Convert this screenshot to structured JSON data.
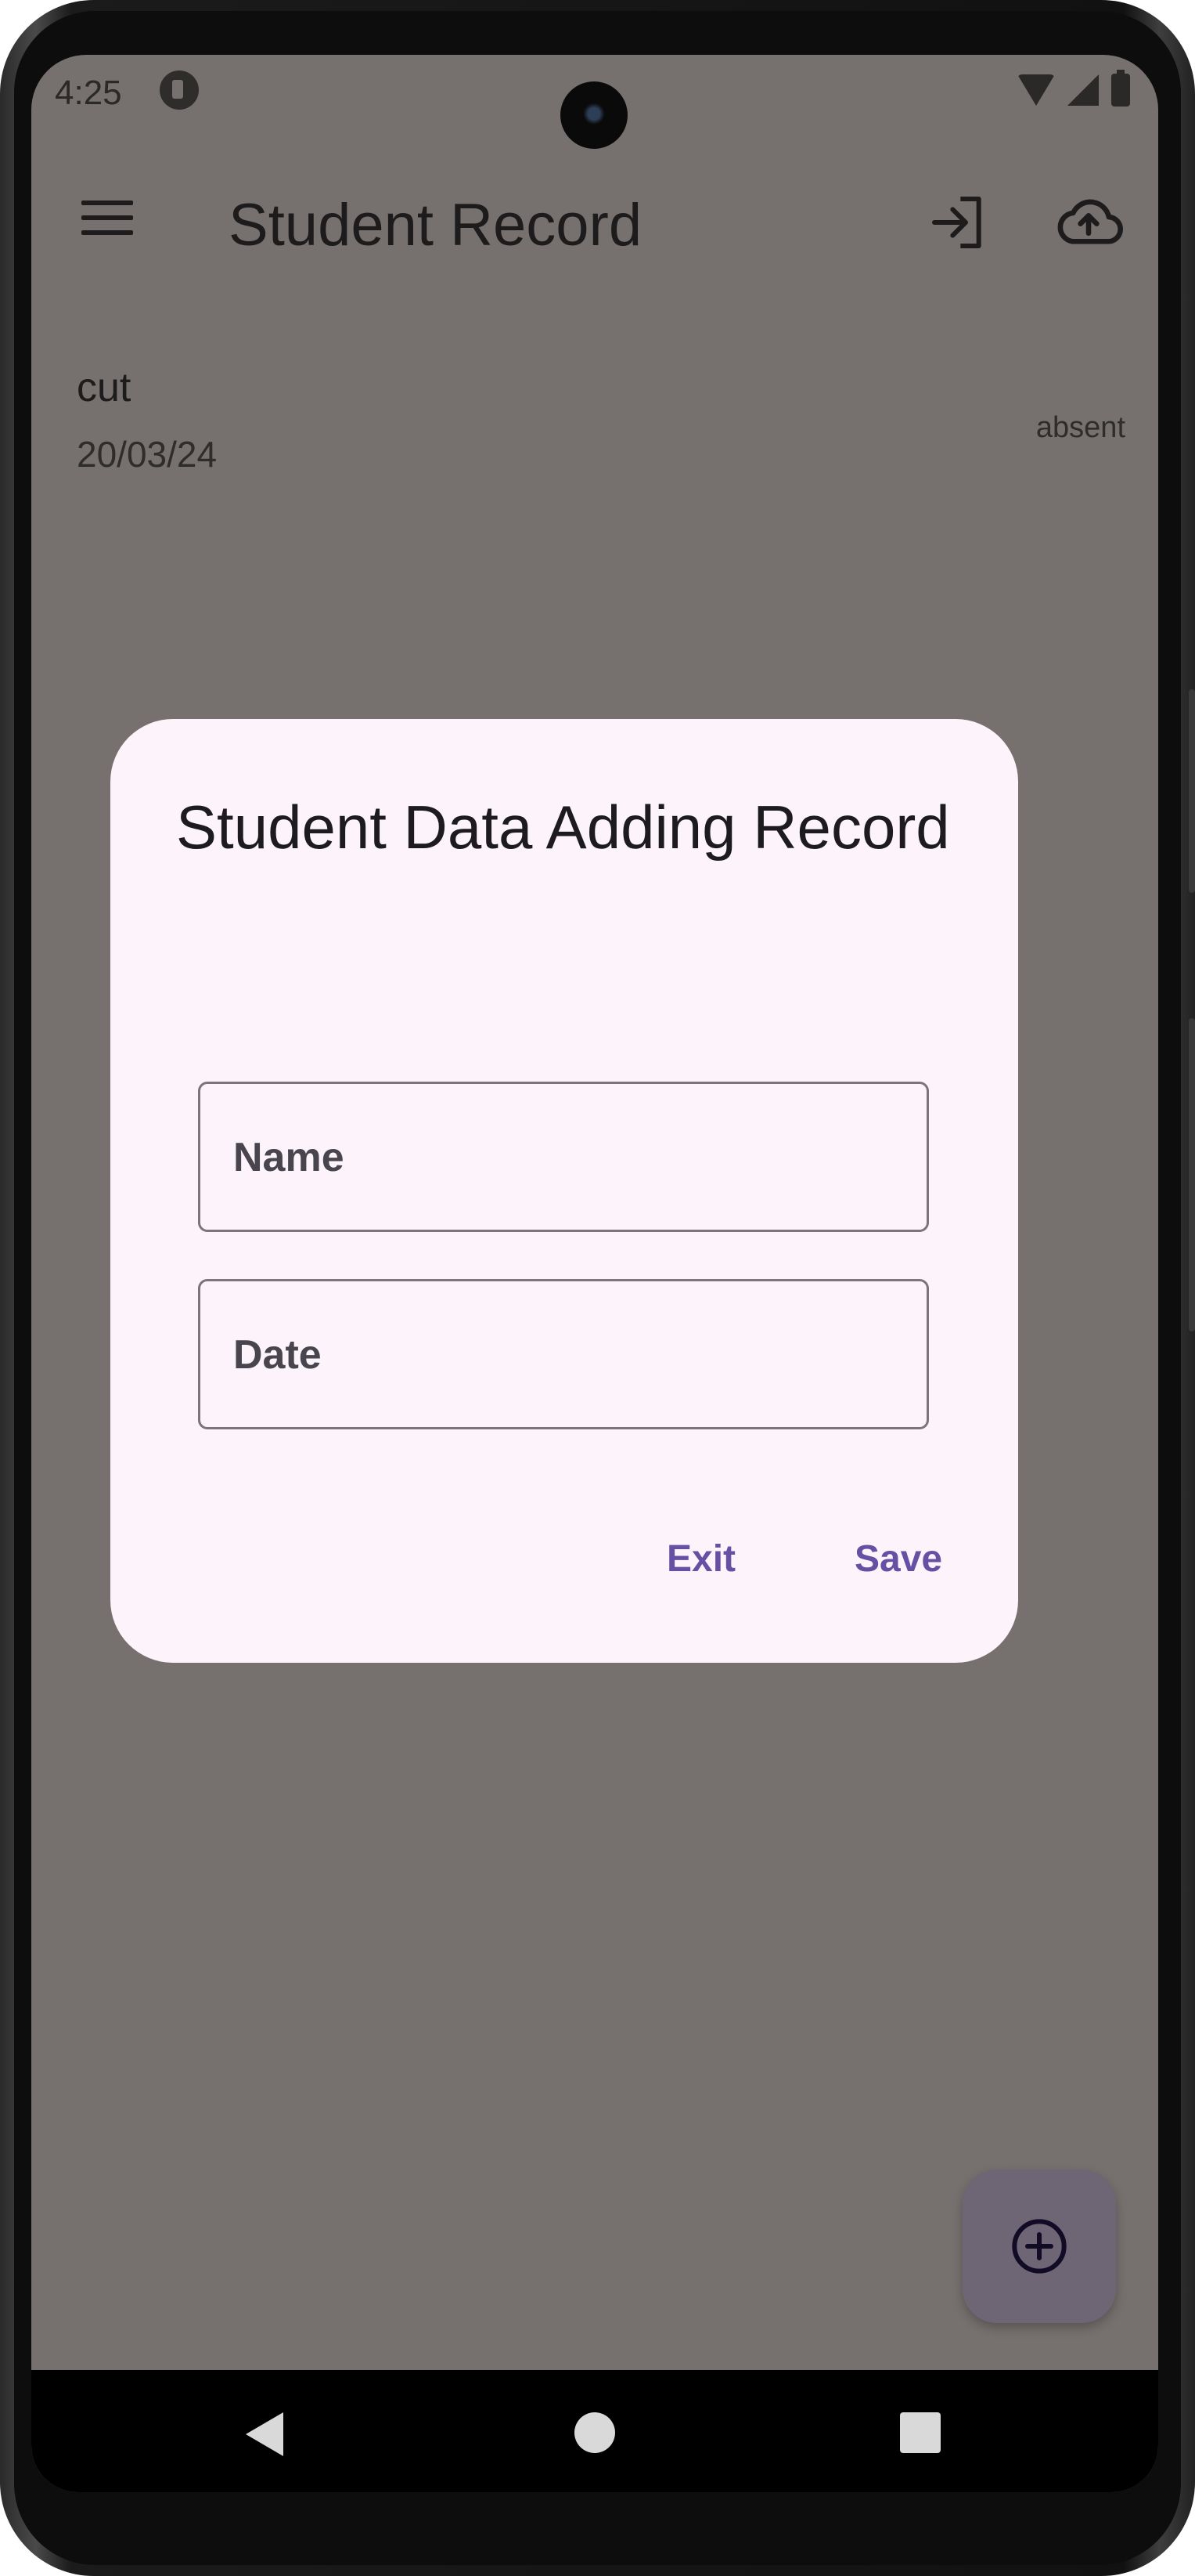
{
  "status_bar": {
    "time": "4:25"
  },
  "app_bar": {
    "title": "Student Record"
  },
  "records": [
    {
      "name": "cut",
      "date": "20/03/24",
      "status": "absent"
    }
  ],
  "dialog": {
    "title": "Student Data Adding Record",
    "name_field": {
      "placeholder": "Name",
      "value": ""
    },
    "date_field": {
      "placeholder": "Date",
      "value": ""
    },
    "exit_label": "Exit",
    "save_label": "Save"
  },
  "colors": {
    "scrim_background": "#76716f",
    "dialog_surface": "#fcf4fa",
    "primary": "#6750a4",
    "fab": "#6e6675"
  }
}
